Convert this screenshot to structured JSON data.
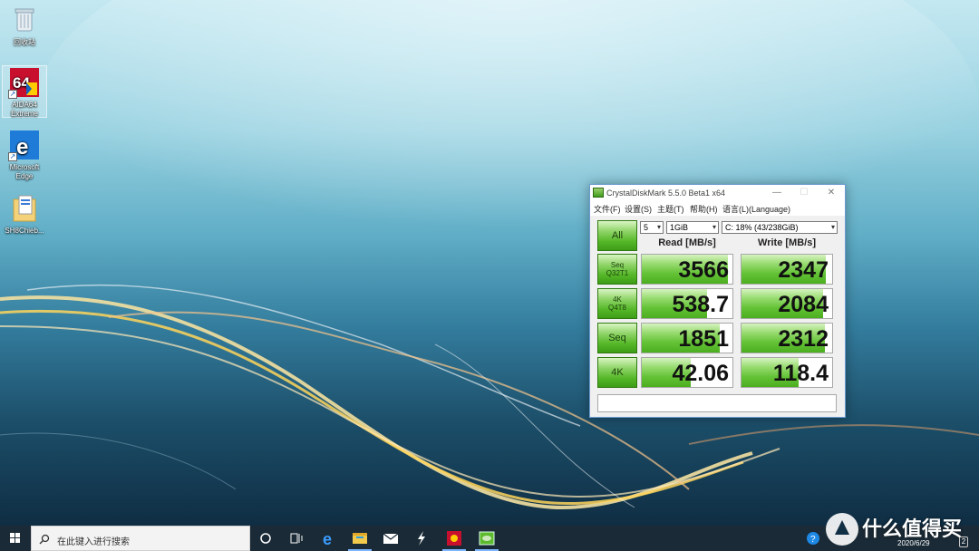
{
  "desktop": {
    "icons": [
      {
        "label": "回收站",
        "icon": "recycle-bin-icon"
      },
      {
        "label": "AIDA64 Extreme",
        "icon": "aida64-icon"
      },
      {
        "label": "Microsoft Edge",
        "icon": "edge-icon"
      },
      {
        "label": "SH8Chieb...",
        "icon": "folder-document-icon"
      }
    ]
  },
  "cdm": {
    "title": "CrystalDiskMark 5.5.0 Beta1 x64",
    "menu": [
      "文件(F)",
      "设置(S)",
      "主题(T)",
      "帮助(H)",
      "语言(L)(Language)"
    ],
    "all_button": "All",
    "count_select": "5",
    "size_select": "1GiB",
    "drive_select": "C: 18% (43/238GiB)",
    "read_header": "Read [MB/s]",
    "write_header": "Write [MB/s]",
    "tests": [
      {
        "line1": "Seq",
        "line2": "Q32T1",
        "read": "3566",
        "write": "2347",
        "read_fill": 0.95,
        "write_fill": 0.93
      },
      {
        "line1": "4K",
        "line2": "Q4T8",
        "read": "538.7",
        "write": "2084",
        "read_fill": 0.72,
        "write_fill": 0.9
      },
      {
        "line1": "Seq",
        "line2": "",
        "read": "1851",
        "write": "2312",
        "read_fill": 0.86,
        "write_fill": 0.92
      },
      {
        "line1": "4K",
        "line2": "",
        "read": "42.06",
        "write": "118.4",
        "read_fill": 0.54,
        "write_fill": 0.63
      }
    ],
    "comment": ""
  },
  "taskbar": {
    "search_placeholder": "在此键入进行搜索",
    "apps": [
      "cortana-icon",
      "task-view-icon",
      "edge-icon",
      "file-explorer-icon",
      "mail-icon",
      "app-bolt-icon",
      "aida64-icon",
      "crystaldiskmark-icon"
    ],
    "date": "2020/6/29",
    "notification_count": "2"
  },
  "watermark": {
    "text": "什么值得买"
  },
  "colors": {
    "accent_green": "#55b728",
    "taskbar": "#1a2a36",
    "window_border": "#6b9ad1"
  }
}
